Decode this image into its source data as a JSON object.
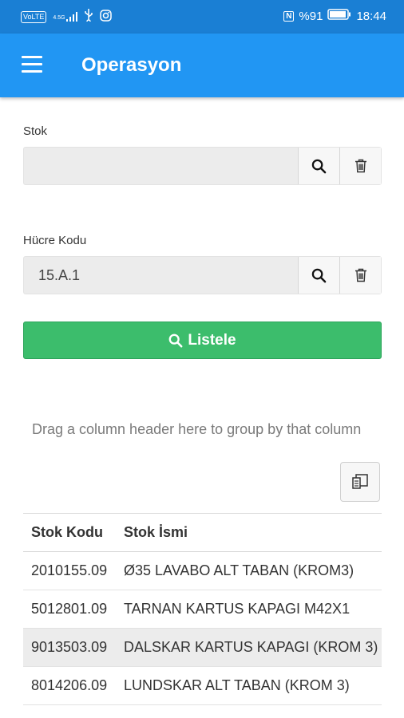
{
  "status_bar": {
    "carrier_chip": "VoLTE",
    "network": "4.5G",
    "nfc": "N",
    "battery": "%91",
    "time": "18:44"
  },
  "app_bar": {
    "title": "Operasyon"
  },
  "stok": {
    "label": "Stok",
    "value": "",
    "placeholder": ""
  },
  "hucre": {
    "label": "Hücre Kodu",
    "value": "15.A.1"
  },
  "listele_label": "Listele",
  "group_hint": "Drag a column header here to group by that column",
  "grid": {
    "columns": [
      "Stok Kodu",
      "Stok İsmi"
    ],
    "rows": [
      {
        "code": "2010155.09",
        "name": "Ø35 LAVABO ALT TABAN (KROM3)"
      },
      {
        "code": "5012801.09",
        "name": "TARNAN KARTUS KAPAGI M42X1"
      },
      {
        "code": "9013503.09",
        "name": "DALSKAR KARTUS KAPAGI (KROM 3)"
      },
      {
        "code": "8014206.09",
        "name": "LUNDSKAR ALT TABAN (KROM 3)"
      }
    ]
  },
  "colors": {
    "status_bar": "#1a7fd4",
    "app_bar": "#2196f3",
    "listele": "#3cbd6c"
  },
  "icons": [
    "menu-icon",
    "search-icon",
    "trash-icon",
    "column-chooser-icon"
  ]
}
